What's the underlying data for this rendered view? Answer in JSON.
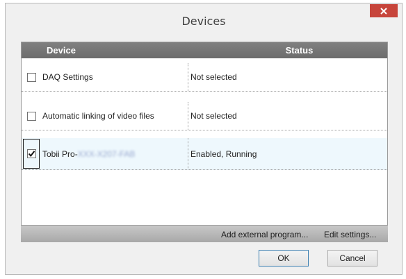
{
  "window": {
    "title": "Devices",
    "close_icon": "close-icon"
  },
  "grid": {
    "columns": [
      "Device",
      "Status"
    ],
    "rows": [
      {
        "device": "DAQ Settings",
        "device_blurred": "",
        "status": "Not selected",
        "checked": false
      },
      {
        "device": "Automatic linking of video files",
        "device_blurred": "",
        "status": "Not selected",
        "checked": false
      },
      {
        "device": "Tobii Pro-",
        "device_blurred": "XXX-X207-FAB",
        "status": "Enabled, Running",
        "checked": true
      }
    ]
  },
  "toolbar": {
    "add_external": "Add external program...",
    "edit_settings": "Edit settings..."
  },
  "buttons": {
    "ok": "OK",
    "cancel": "Cancel"
  },
  "colors": {
    "close_button": "#c7453b",
    "header_bg": "#7a7a7a",
    "selected_row": "#eef8fd"
  }
}
